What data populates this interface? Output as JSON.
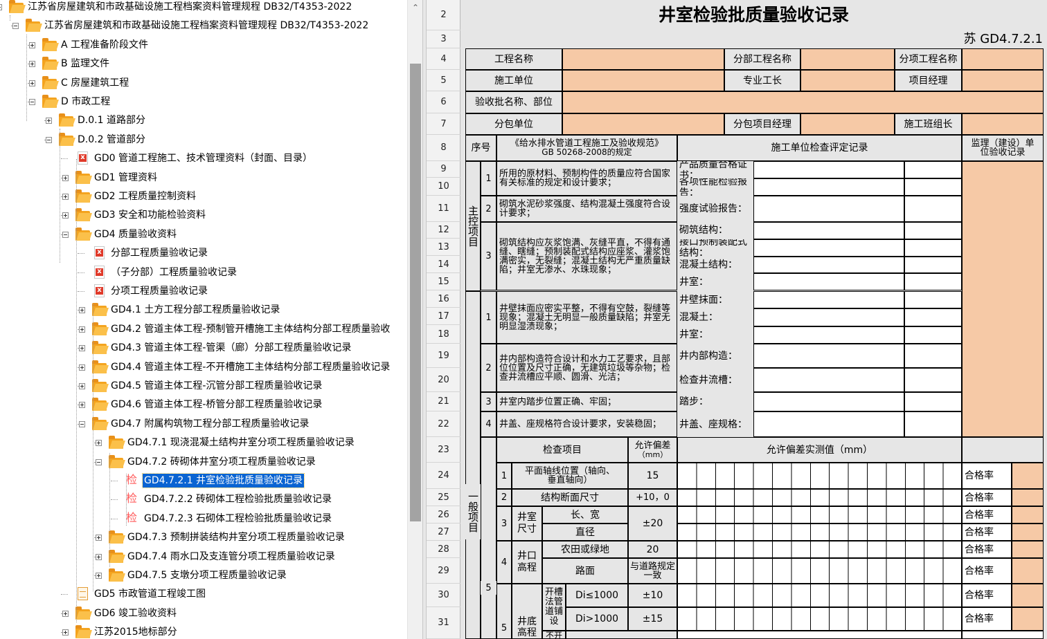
{
  "tree": {
    "nodes": [
      {
        "label": "江苏省房屋建筑和市政基础设施工程档案资料管理规程 DB32/T4353-2022",
        "icon": "folder"
      },
      {
        "label": "江苏省房屋建筑和市政基础设施工程档案资料管理规程 DB32/T4353-2022",
        "icon": "folder"
      },
      {
        "label": "A 工程准备阶段文件",
        "icon": "folder"
      },
      {
        "label": "B 监理文件",
        "icon": "folder"
      },
      {
        "label": "C 房屋建筑工程",
        "icon": "folder"
      },
      {
        "label": "D 市政工程",
        "icon": "folder"
      },
      {
        "label": "D.0.1 道路部分",
        "icon": "folder"
      },
      {
        "label": "D.0.2 管道部分",
        "icon": "folder"
      },
      {
        "label": "GD0 管道工程施工、技术管理资料（封面、目录）",
        "icon": "excel-file"
      },
      {
        "label": "GD1 管理资料",
        "icon": "folder"
      },
      {
        "label": "GD2 工程质量控制资料",
        "icon": "folder"
      },
      {
        "label": "GD3 安全和功能检验资料",
        "icon": "folder"
      },
      {
        "label": "GD4 质量验收资料",
        "icon": "folder"
      },
      {
        "label": "分部工程质量验收记录",
        "icon": "excel-file"
      },
      {
        "label": "（子分部）工程质量验收记录",
        "icon": "excel-file"
      },
      {
        "label": "分项工程质量验收记录",
        "icon": "excel-file"
      },
      {
        "label": "GD4.1 土方工程分部工程质量验收记录",
        "icon": "folder"
      },
      {
        "label": "GD4.2 管道主体工程-预制管开槽施工主体结构分部工程质量验收",
        "icon": "folder"
      },
      {
        "label": "GD4.3 管道主体工程-管渠（廊）分部工程质量验收记录",
        "icon": "folder"
      },
      {
        "label": "GD4.4 管道主体工程-不开槽施工主体结构分部工程质量验收记录",
        "icon": "folder"
      },
      {
        "label": "GD4.5 管道主体工程-沉管分部工程质量验收记录",
        "icon": "folder"
      },
      {
        "label": "GD4.6 管道主体工程-桥管分部工程质量验收记录",
        "icon": "folder"
      },
      {
        "label": "GD4.7 附属构筑物工程分部工程质量验收记录",
        "icon": "folder"
      },
      {
        "label": "GD4.7.1 现浇混凝土结构井室分项工程质量验收记录",
        "icon": "folder"
      },
      {
        "label": "GD4.7.2 砖砌体井室分项工程质量验收记录",
        "icon": "folder"
      },
      {
        "label": "GD4.7.2.1 井室检验批质量验收记录",
        "icon": "check-doc",
        "selected": true
      },
      {
        "label": "GD4.7.2.2 砖砌体工程检验批质量验收记录",
        "icon": "check-doc"
      },
      {
        "label": "GD4.7.2.3 石砌体工程检验批质量验收记录",
        "icon": "check-doc"
      },
      {
        "label": "GD4.7.3 预制拼装结构井室分项工程质量验收记录",
        "icon": "folder"
      },
      {
        "label": "GD4.7.4 雨水口及支连管分项工程质量验收记录",
        "icon": "folder"
      },
      {
        "label": "GD4.7.5 支墩分项工程质量验收记录",
        "icon": "folder"
      },
      {
        "label": "GD5 市政管道工程竣工图",
        "icon": "doc-file"
      },
      {
        "label": "GD6 竣工验收资料",
        "icon": "folder"
      },
      {
        "label": "江苏2015地标部分",
        "icon": "folder"
      }
    ],
    "check_glyph": "检"
  },
  "scrollbar": {
    "up_arrow": "⌃"
  },
  "sheet": {
    "row_numbers": [
      "2",
      "3",
      "4",
      "5",
      "6",
      "7",
      "8",
      "9",
      "10",
      "11",
      "12",
      "13",
      "14",
      "15",
      "16",
      "17",
      "18",
      "19",
      "20",
      "21",
      "22",
      "23",
      "24",
      "25",
      "26",
      "27",
      "28",
      "29",
      "30",
      "31"
    ],
    "title": "井室检验批质量验收记录",
    "code": "苏 GD4.7.2.1",
    "header": {
      "project_name": "工程名称",
      "division_name": "分部工程名称",
      "item_name": "分项工程名称",
      "contractor": "施工单位",
      "foreman": "专业工长",
      "project_manager": "项目经理",
      "batch_name": "验收批名称、部位",
      "subcontractor": "分包单位",
      "sub_pm": "分包项目经理",
      "team_leader": "施工班组长"
    },
    "col_headers": {
      "seq": "序号",
      "spec_line1": "《给水排水管道工程施工及验收规范》",
      "spec_line2": "GB 50268-2008的规定",
      "contractor_record": "施工单位检查评定记录",
      "supervisor_line1": "监理（建设）单",
      "supervisor_line2": "位验收记录"
    },
    "main_label": "主控项目",
    "general_label": "一般项目",
    "main_items": [
      {
        "no": "1",
        "text": "所用的原材料、预制构件的质量应符合国家有关标准的规定和设计要求；",
        "checks": [
          "产品质量合格证书：",
          "各项性能检验报告："
        ]
      },
      {
        "no": "2",
        "text": "砌筑水泥砂浆强度、结构混凝土强度符合设计要求；",
        "checks": [
          "强度试验报告："
        ]
      },
      {
        "no": "3",
        "text": "砌筑结构应灰浆饱满、灰缝平直，不得有通缝、瞎缝；预制装配式结构应座浆、灌浆饱满密实，无裂缝；混凝土结构无严重质量缺陷；井室无渗水、水珠现象；",
        "checks": [
          "砌筑结构：",
          "接口预制装配式结构：",
          "混凝土结构：",
          "井室："
        ]
      }
    ],
    "general_items": [
      {
        "no": "1",
        "text": "井壁抹面应密实平整，不得有空鼓，裂缝等现象；混凝土无明显一般质量缺陷；井室无明显湿渍现象；",
        "checks": [
          "井壁抹面：",
          "混凝土：",
          "井室："
        ]
      },
      {
        "no": "2",
        "text": "井内部构造符合设计和水力工艺要求，且部位位置及尺寸正确，无建筑垃圾等杂物；检查井流槽应平顺、圆滑、光洁；",
        "checks": [
          "井内部构造：",
          "检查井流槽："
        ]
      },
      {
        "no": "3",
        "text": "井室内踏步位置正确、牢固；",
        "checks": [
          "踏步："
        ]
      },
      {
        "no": "4",
        "text": "井盖、座规格符合设计要求，安装稳固；",
        "checks": [
          "井盖、座规格："
        ]
      }
    ],
    "deviation": {
      "check_item": "检查项目",
      "allow_line1": "允许偏差",
      "allow_line2": "（mm）",
      "measured": "允许偏差实测值（mm）",
      "pass_rate": "合格率",
      "rows": [
        {
          "no": "1",
          "item_line1": "平面轴线位置（轴向、",
          "item_line2": "垂直轴向）",
          "allow": "15"
        },
        {
          "no": "2",
          "item": "结构断面尺寸",
          "allow": "+10，0"
        },
        {
          "no": "3",
          "group": "井室尺寸",
          "sub": [
            "长、宽",
            "直径"
          ],
          "allow": "±20"
        },
        {
          "no": "4",
          "group": "井口高程",
          "sub": [
            "农田或绿地",
            "路面"
          ],
          "allow": [
            "20",
            "与道路规定一致"
          ]
        },
        {
          "no": "5",
          "group": "井底高程",
          "subgroup": "开槽法管道铺设",
          "sub": [
            "Di≤1000",
            "Di>1000"
          ],
          "allow": [
            "±10",
            "±15"
          ],
          "partial": "不开"
        }
      ],
      "outer_no": "5"
    }
  }
}
